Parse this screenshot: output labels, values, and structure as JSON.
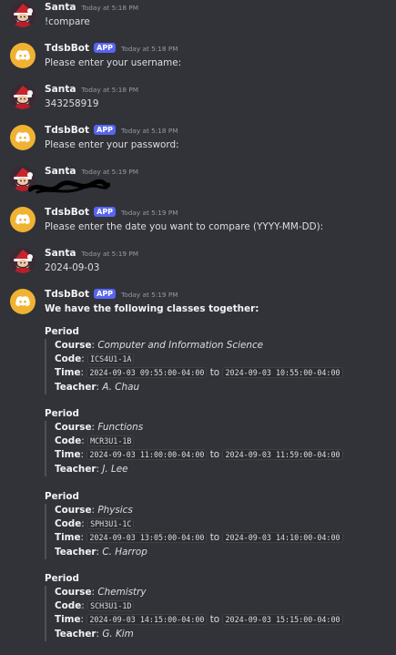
{
  "messages": [
    {
      "author": "Santa",
      "timestamp": "Today at 5:18 PM",
      "text": "!compare",
      "avatar": "santa-avatar"
    },
    {
      "author": "TdsbBot",
      "app_tag": "APP",
      "timestamp": "Today at 5:18 PM",
      "text": "Please enter your username:",
      "avatar": "discord-bot-icon"
    },
    {
      "author": "Santa",
      "timestamp": "Today at 5:18 PM",
      "text": "343258919",
      "avatar": "santa-avatar"
    },
    {
      "author": "TdsbBot",
      "app_tag": "APP",
      "timestamp": "Today at 5:18 PM",
      "text": "Please enter your password:",
      "avatar": "discord-bot-icon"
    },
    {
      "author": "Santa",
      "timestamp": "Today at 5:19 PM",
      "text": "",
      "avatar": "santa-avatar",
      "redacted": true
    },
    {
      "author": "TdsbBot",
      "app_tag": "APP",
      "timestamp": "Today at 5:19 PM",
      "text": "Please enter the date you want to compare (YYYY-MM-DD):",
      "avatar": "discord-bot-icon"
    },
    {
      "author": "Santa",
      "timestamp": "Today at 5:19 PM",
      "text": "2024-09-03",
      "avatar": "santa-avatar"
    },
    {
      "author": "TdsbBot",
      "app_tag": "APP",
      "timestamp": "Today at 5:19 PM",
      "text": "We have the following classes together:",
      "avatar": "discord-bot-icon"
    }
  ],
  "labels": {
    "period": "Period",
    "course": "Course",
    "code": "Code",
    "time": "Time",
    "teacher": "Teacher",
    "to": "to",
    "colon": ":"
  },
  "periods": [
    {
      "course": "Computer and Information Science",
      "code": "ICS4U1-1A",
      "start": "2024-09-03 09:55:00-04:00",
      "end": "2024-09-03 10:55:00-04:00",
      "teacher": "A. Chau"
    },
    {
      "course": "Functions",
      "code": "MCR3U1-1B",
      "start": "2024-09-03 11:00:00-04:00",
      "end": "2024-09-03 11:59:00-04:00",
      "teacher": "J. Lee"
    },
    {
      "course": "Physics",
      "code": "SPH3U1-1C",
      "start": "2024-09-03 13:05:00-04:00",
      "end": "2024-09-03 14:10:00-04:00",
      "teacher": "C. Harrop"
    },
    {
      "course": "Chemistry",
      "code": "SCH3U1-1D",
      "start": "2024-09-03 14:15:00-04:00",
      "end": "2024-09-03 15:15:00-04:00",
      "teacher": "G. Kim"
    }
  ],
  "colors": {
    "background": "#313338",
    "app_tag": "#5865f2",
    "bot_avatar": "#f0b232"
  }
}
